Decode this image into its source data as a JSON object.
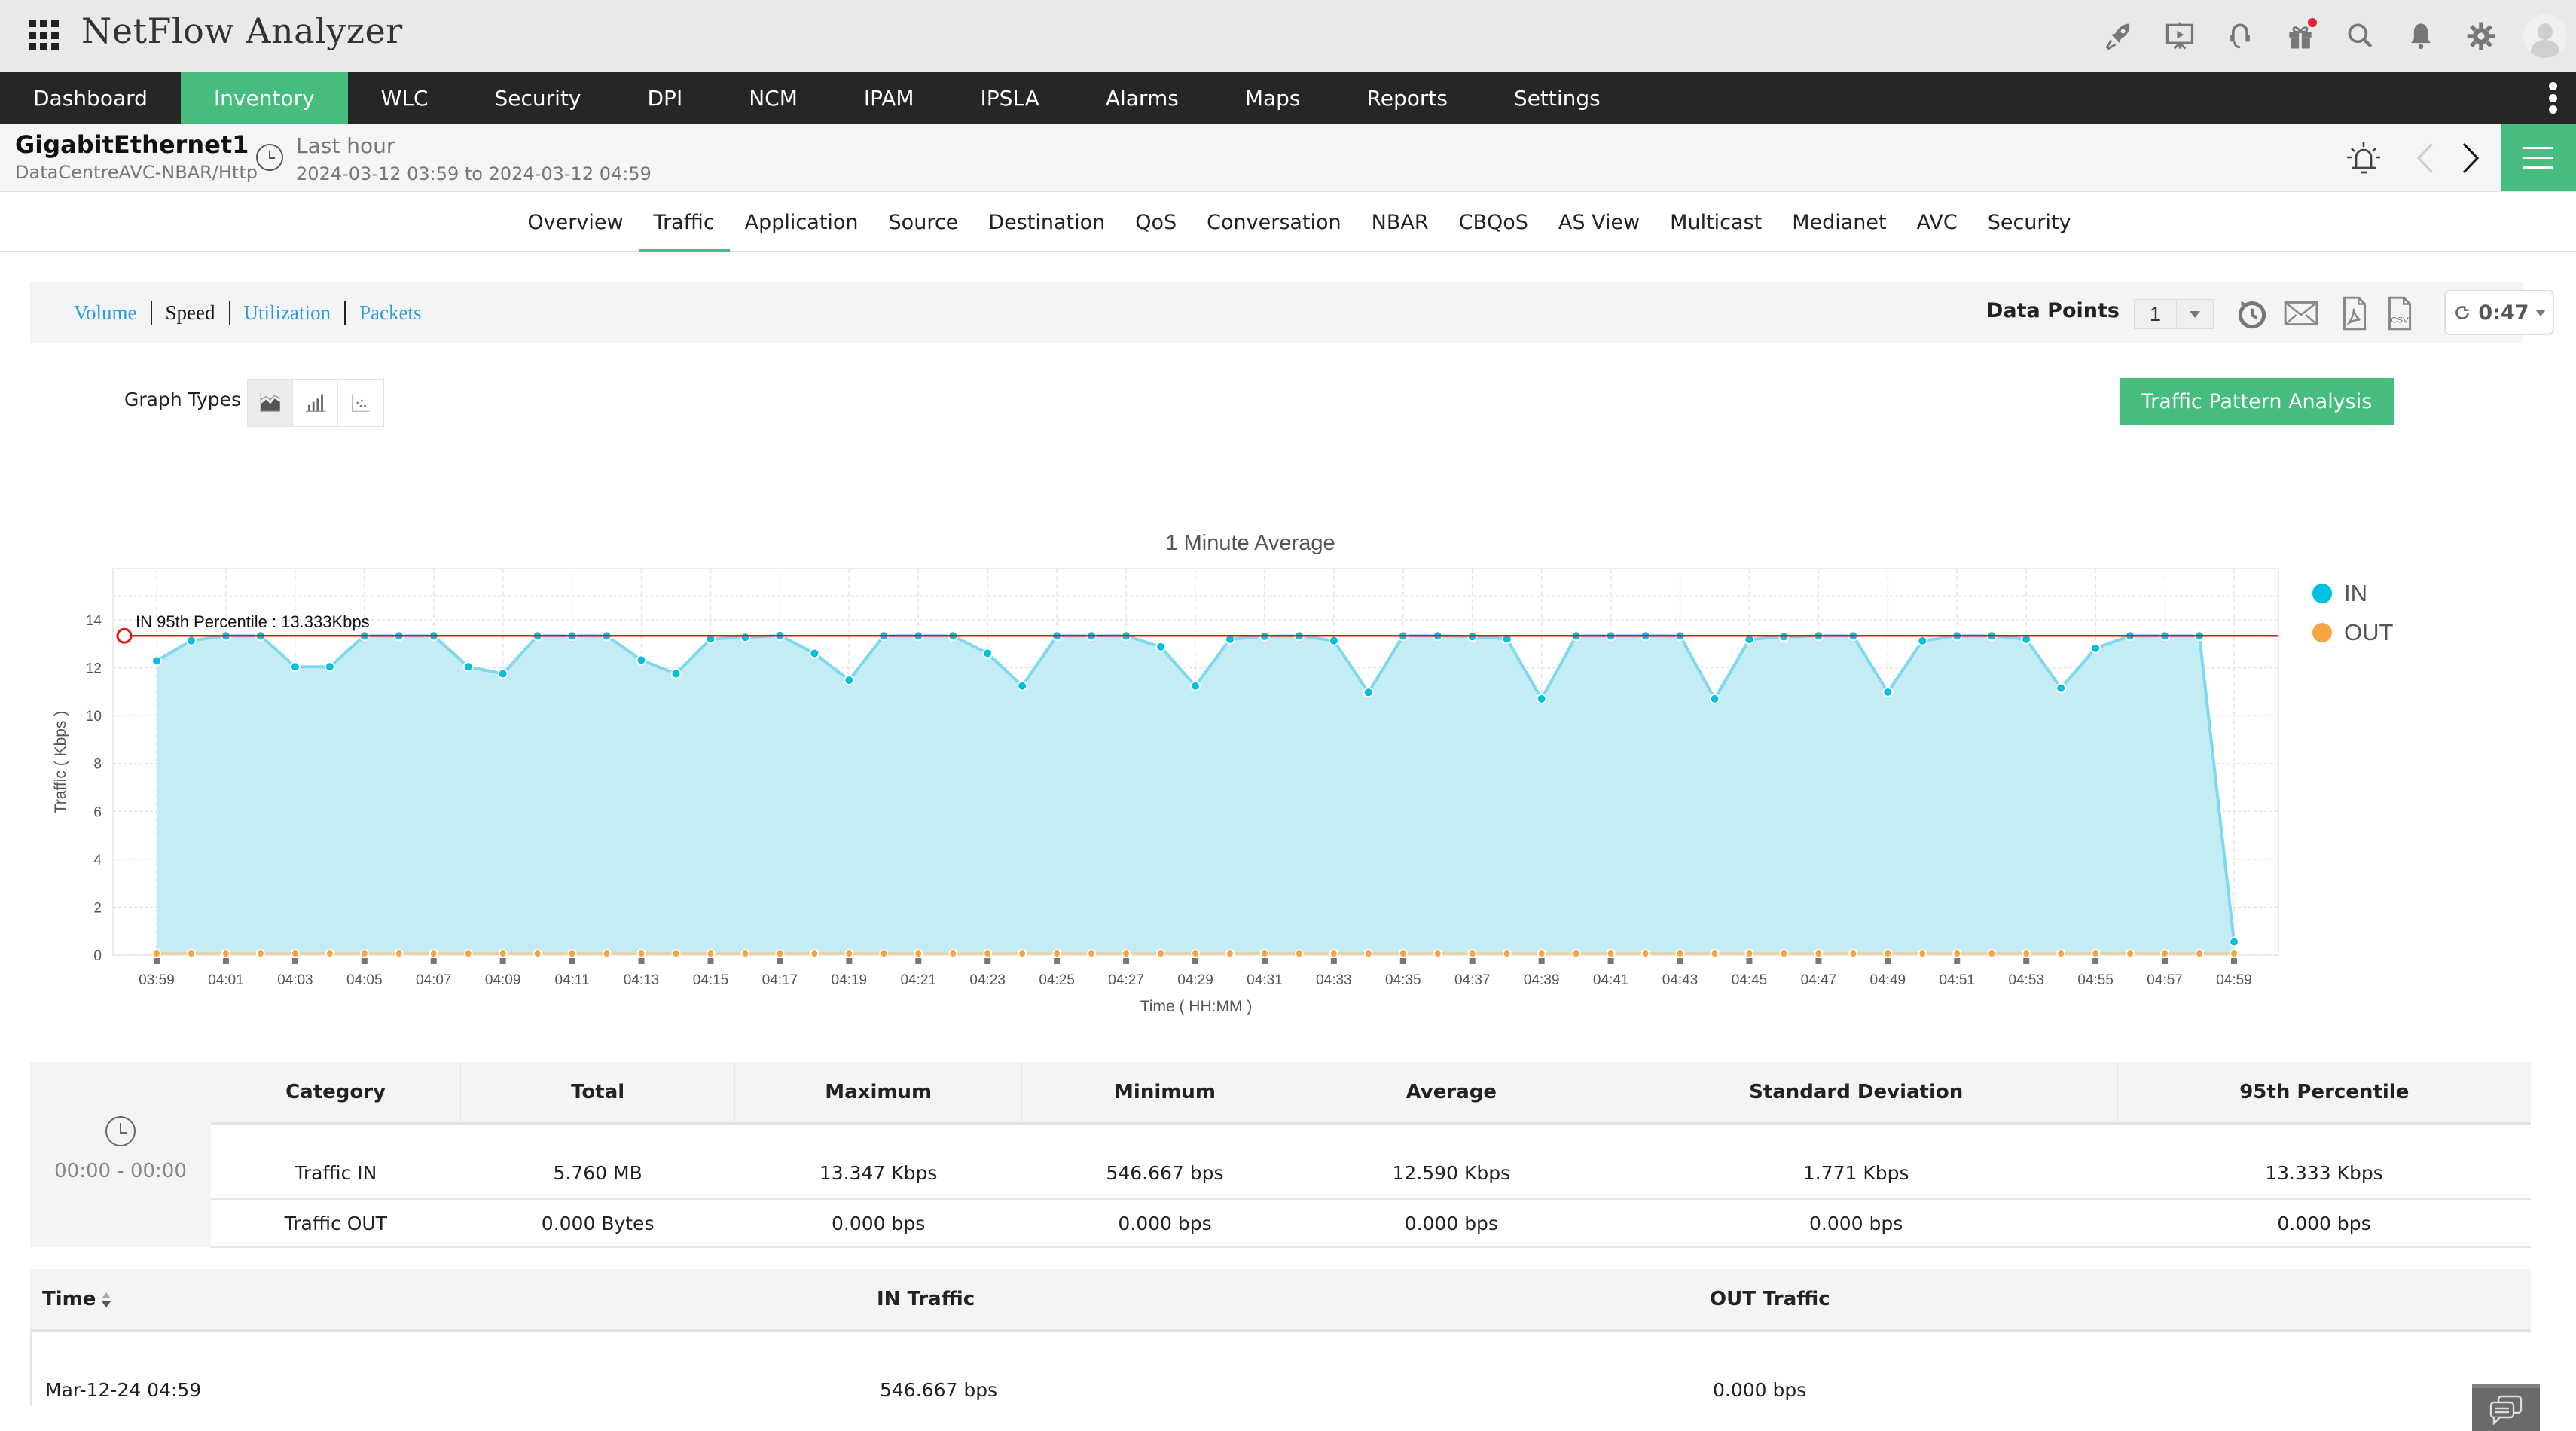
{
  "header": {
    "app_title": "NetFlow Analyzer",
    "icons": [
      "rocket-icon",
      "presentation-icon",
      "support-headset-icon",
      "gift-icon",
      "search-icon",
      "bell-icon",
      "gear-icon",
      "user-avatar"
    ]
  },
  "mainnav": {
    "items": [
      {
        "label": "Dashboard",
        "active": false
      },
      {
        "label": "Inventory",
        "active": true
      },
      {
        "label": "WLC",
        "active": false
      },
      {
        "label": "Security",
        "active": false
      },
      {
        "label": "DPI",
        "active": false
      },
      {
        "label": "NCM",
        "active": false
      },
      {
        "label": "IPAM",
        "active": false
      },
      {
        "label": "IPSLA",
        "active": false
      },
      {
        "label": "Alarms",
        "active": false
      },
      {
        "label": "Maps",
        "active": false
      },
      {
        "label": "Reports",
        "active": false
      },
      {
        "label": "Settings",
        "active": false
      }
    ]
  },
  "titlebar": {
    "interface_name": "GigabitEthernet1",
    "interface_path": "DataCentreAVC-NBAR/Http",
    "range_label": "Last hour",
    "range_value": "2024-03-12 03:59 to 2024-03-12 04:59"
  },
  "subtabs": [
    {
      "label": "Overview",
      "active": false
    },
    {
      "label": "Traffic",
      "active": true
    },
    {
      "label": "Application",
      "active": false
    },
    {
      "label": "Source",
      "active": false
    },
    {
      "label": "Destination",
      "active": false
    },
    {
      "label": "QoS",
      "active": false
    },
    {
      "label": "Conversation",
      "active": false
    },
    {
      "label": "NBAR",
      "active": false
    },
    {
      "label": "CBQoS",
      "active": false
    },
    {
      "label": "AS View",
      "active": false
    },
    {
      "label": "Multicast",
      "active": false
    },
    {
      "label": "Medianet",
      "active": false
    },
    {
      "label": "AVC",
      "active": false
    },
    {
      "label": "Security",
      "active": false
    }
  ],
  "toolbar": {
    "metric_tabs": [
      {
        "label": "Volume",
        "active": false
      },
      {
        "label": "Speed",
        "active": true
      },
      {
        "label": "Utilization",
        "active": false
      },
      {
        "label": "Packets",
        "active": false
      }
    ],
    "data_points_label": "Data Points",
    "data_points_value": "1",
    "refresh_timer": "0:47"
  },
  "graph_types": {
    "label": "Graph Types",
    "options": [
      "area-chart",
      "bar-chart",
      "scatter-chart"
    ],
    "selected": "area-chart"
  },
  "traffic_pattern_button": "Traffic Pattern Analysis",
  "colors": {
    "accent": "#47bc7f",
    "in_series": "#00c0e0",
    "out_series": "#f7a540",
    "percentile_line": "#ee1111",
    "link": "#2b9be0",
    "nav_bg": "#262626"
  },
  "chart_data": {
    "type": "area",
    "title": "1 Minute Average",
    "xlabel": "Time ( HH:MM )",
    "ylabel": "Traffic ( Kbps )",
    "ylim": [
      0,
      16
    ],
    "yticks": [
      0,
      2,
      4,
      6,
      8,
      10,
      12,
      14
    ],
    "grid": true,
    "legend_position": "right",
    "x": [
      "03:59",
      "04:00",
      "04:01",
      "04:02",
      "04:03",
      "04:04",
      "04:05",
      "04:06",
      "04:07",
      "04:08",
      "04:09",
      "04:10",
      "04:11",
      "04:12",
      "04:13",
      "04:14",
      "04:15",
      "04:16",
      "04:17",
      "04:18",
      "04:19",
      "04:20",
      "04:21",
      "04:22",
      "04:23",
      "04:24",
      "04:25",
      "04:26",
      "04:27",
      "04:28",
      "04:29",
      "04:30",
      "04:31",
      "04:32",
      "04:33",
      "04:34",
      "04:35",
      "04:36",
      "04:37",
      "04:38",
      "04:39",
      "04:40",
      "04:41",
      "04:42",
      "04:43",
      "04:44",
      "04:45",
      "04:46",
      "04:47",
      "04:48",
      "04:49",
      "04:50",
      "04:51",
      "04:52",
      "04:53",
      "04:54",
      "04:55",
      "04:56",
      "04:57",
      "04:58",
      "04:59"
    ],
    "xtick_labels": [
      "03:59",
      "04:01",
      "04:03",
      "04:05",
      "04:07",
      "04:09",
      "04:11",
      "04:13",
      "04:15",
      "04:17",
      "04:19",
      "04:21",
      "04:23",
      "04:25",
      "04:27",
      "04:29",
      "04:31",
      "04:33",
      "04:35",
      "04:37",
      "04:39",
      "04:41",
      "04:43",
      "04:45",
      "04:47",
      "04:49",
      "04:51",
      "04:53",
      "04:55",
      "04:57",
      "04:59"
    ],
    "series": [
      {
        "name": "IN",
        "color": "#00c0e0",
        "values": [
          12.29,
          13.13,
          13.33,
          13.33,
          12.04,
          12.04,
          13.33,
          13.33,
          13.33,
          12.04,
          11.75,
          13.33,
          13.33,
          13.33,
          12.32,
          11.75,
          13.2,
          13.27,
          13.347,
          12.6,
          11.48,
          13.33,
          13.33,
          13.33,
          12.6,
          11.24,
          13.33,
          13.33,
          13.33,
          12.87,
          11.24,
          13.19,
          13.31,
          13.33,
          13.13,
          10.97,
          13.33,
          13.33,
          13.3,
          13.2,
          10.7,
          13.33,
          13.33,
          13.33,
          13.33,
          10.7,
          13.18,
          13.29,
          13.33,
          13.33,
          10.98,
          13.12,
          13.33,
          13.33,
          13.19,
          11.15,
          12.81,
          13.33,
          13.33,
          13.33,
          0.547
        ]
      },
      {
        "name": "OUT",
        "color": "#f7a540",
        "values": [
          0,
          0,
          0,
          0,
          0,
          0,
          0,
          0,
          0,
          0,
          0,
          0,
          0,
          0,
          0,
          0,
          0,
          0,
          0,
          0,
          0,
          0,
          0,
          0,
          0,
          0,
          0,
          0,
          0,
          0,
          0,
          0,
          0,
          0,
          0,
          0,
          0,
          0,
          0,
          0,
          0,
          0,
          0,
          0,
          0,
          0,
          0,
          0,
          0,
          0,
          0,
          0,
          0,
          0,
          0,
          0,
          0,
          0,
          0,
          0,
          0
        ]
      }
    ],
    "annotations": [
      {
        "type": "hline",
        "value": 13.333,
        "label": "IN 95th Percentile : 13.333Kbps",
        "color": "#ee1111"
      }
    ]
  },
  "stats": {
    "time_range": "00:00 - 00:00",
    "columns": [
      "Category",
      "Total",
      "Maximum",
      "Minimum",
      "Average",
      "Standard Deviation",
      "95th Percentile"
    ],
    "rows": [
      [
        "Traffic IN",
        "5.760 MB",
        "13.347 Kbps",
        "546.667 bps",
        "12.590 Kbps",
        "1.771 Kbps",
        "13.333 Kbps"
      ],
      [
        "Traffic OUT",
        "0.000 Bytes",
        "0.000 bps",
        "0.000 bps",
        "0.000 bps",
        "0.000 bps",
        "0.000 bps"
      ]
    ]
  },
  "data_table": {
    "columns": [
      "Time",
      "IN Traffic",
      "OUT Traffic"
    ],
    "rows": [
      [
        "Mar-12-24 04:59",
        "546.667 bps",
        "0.000 bps"
      ]
    ]
  }
}
